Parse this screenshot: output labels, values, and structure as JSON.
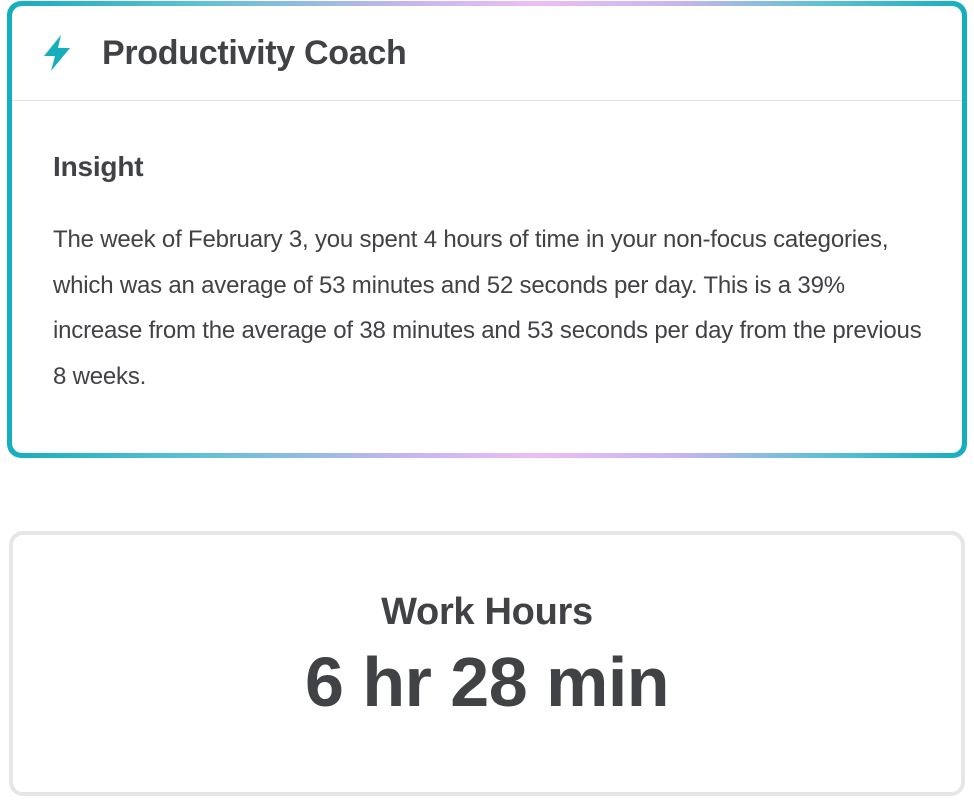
{
  "coach": {
    "icon": "lightning-bolt-icon",
    "title": "Productivity Coach",
    "insight_heading": "Insight",
    "insight_text": "The week of February 3, you spent 4 hours of time in your non-focus categories, which was an average of 53 minutes and 52 seconds per day. This is a 39% increase from the average of 38 minutes and 53 seconds per day from the previous 8 weeks."
  },
  "work_hours": {
    "label": "Work Hours",
    "value": "6 hr 28 min"
  },
  "colors": {
    "accent": "#14aebd",
    "gradient_mid": "#ecbef3",
    "text": "#414245",
    "card_border": "#e6e6e8"
  }
}
